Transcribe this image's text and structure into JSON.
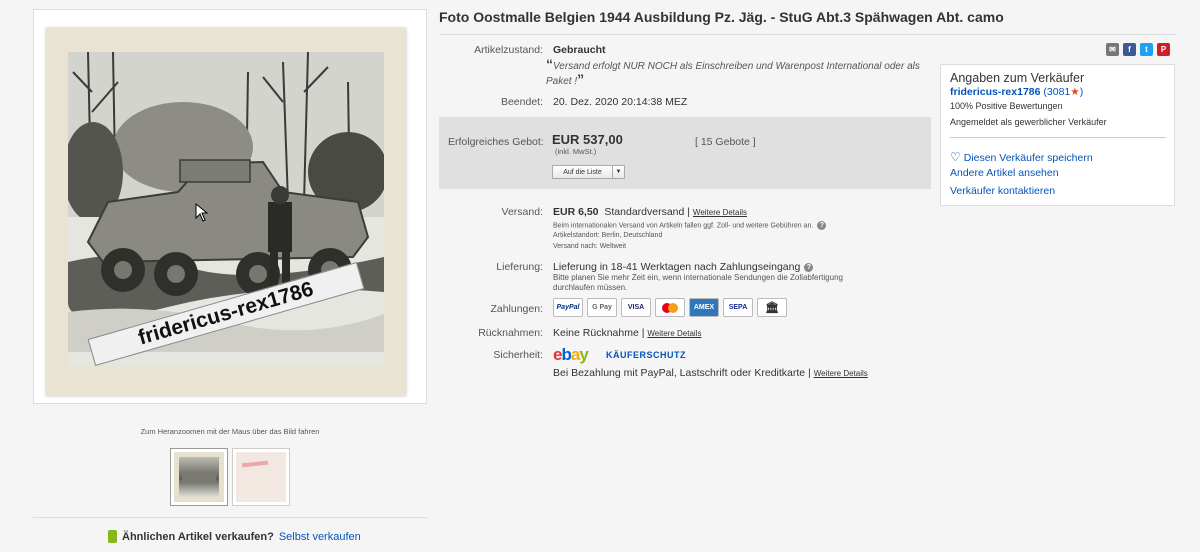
{
  "listing": {
    "title": "Foto Oostmalle Belgien 1944 Ausbildung Pz. Jäg. - StuG Abt.3 Spähwagen Abt. camo",
    "watermark": "fridericus-rex1786"
  },
  "gallery": {
    "zoom_hint": "Zum Heranzoomen mit der Maus über das Bild fahren",
    "thumb_count": 2
  },
  "sell_similar": {
    "question": "Ähnlichen Artikel verkaufen?",
    "link": "Selbst verkaufen"
  },
  "details": {
    "condition_label": "Artikelzustand:",
    "condition_value": "Gebraucht",
    "condition_note": "Versand erfolgt NUR NOCH als Einschreiben und Warenpost International oder als Paket !",
    "ended_label": "Beendet:",
    "ended_value": "20. Dez. 2020  20:14:38 MEZ"
  },
  "bid": {
    "label": "Erfolgreiches Gebot:",
    "price": "EUR 537,00",
    "tax": "(inkl. MwSt.)",
    "count": "[ 15 Gebote ]",
    "watch_button": "Auf die Liste"
  },
  "shipping": {
    "label": "Versand:",
    "price": "EUR 6,50",
    "method": "Standardversand",
    "more": "Weitere Details",
    "intl_note": "Beim internationalen Versand von Artikeln fallen ggf. Zoll- und weitere Gebühren an.",
    "location": "Artikelstandort:  Berlin, Deutschland",
    "ships_to": "Versand nach:  Weltweit"
  },
  "delivery": {
    "label": "Lieferung:",
    "value": "Lieferung in 18-41 Werktagen nach Zahlungseingang",
    "note_line1": "Bitte planen Sie mehr Zeit ein, wenn internationale Sendungen die Zollabfertigung",
    "note_line2": "durchlaufen müssen."
  },
  "payments": {
    "label": "Zahlungen:",
    "methods": [
      "PayPal",
      "G Pay",
      "VISA",
      "Mastercard",
      "AMEX",
      "SEPA",
      "Bank"
    ]
  },
  "returns": {
    "label": "Rücknahmen:",
    "value": "Keine Rücknahme",
    "more": "Weitere Details"
  },
  "security": {
    "label": "Sicherheit:",
    "protection": "KÄUFERSCHUTZ",
    "text": "Bei Bezahlung mit PayPal, Lastschrift oder Kreditkarte",
    "more": "Weitere Details"
  },
  "seller": {
    "heading": "Angaben zum Verkäufer",
    "name": "fridericus-rex1786",
    "score": "(3081",
    "score_close": ")",
    "positive": "100% Positive Bewertungen",
    "type": "Angemeldet als gewerblicher Verkäufer",
    "save": "Diesen Verkäufer speichern",
    "other_items": "Andere Artikel ansehen",
    "contact": "Verkäufer kontaktieren"
  },
  "colors": {
    "link": "#0654ba",
    "bid_box": "#e0e0e0",
    "facebook": "#3b5998",
    "twitter": "#1da1f2",
    "pinterest": "#cb2027"
  }
}
